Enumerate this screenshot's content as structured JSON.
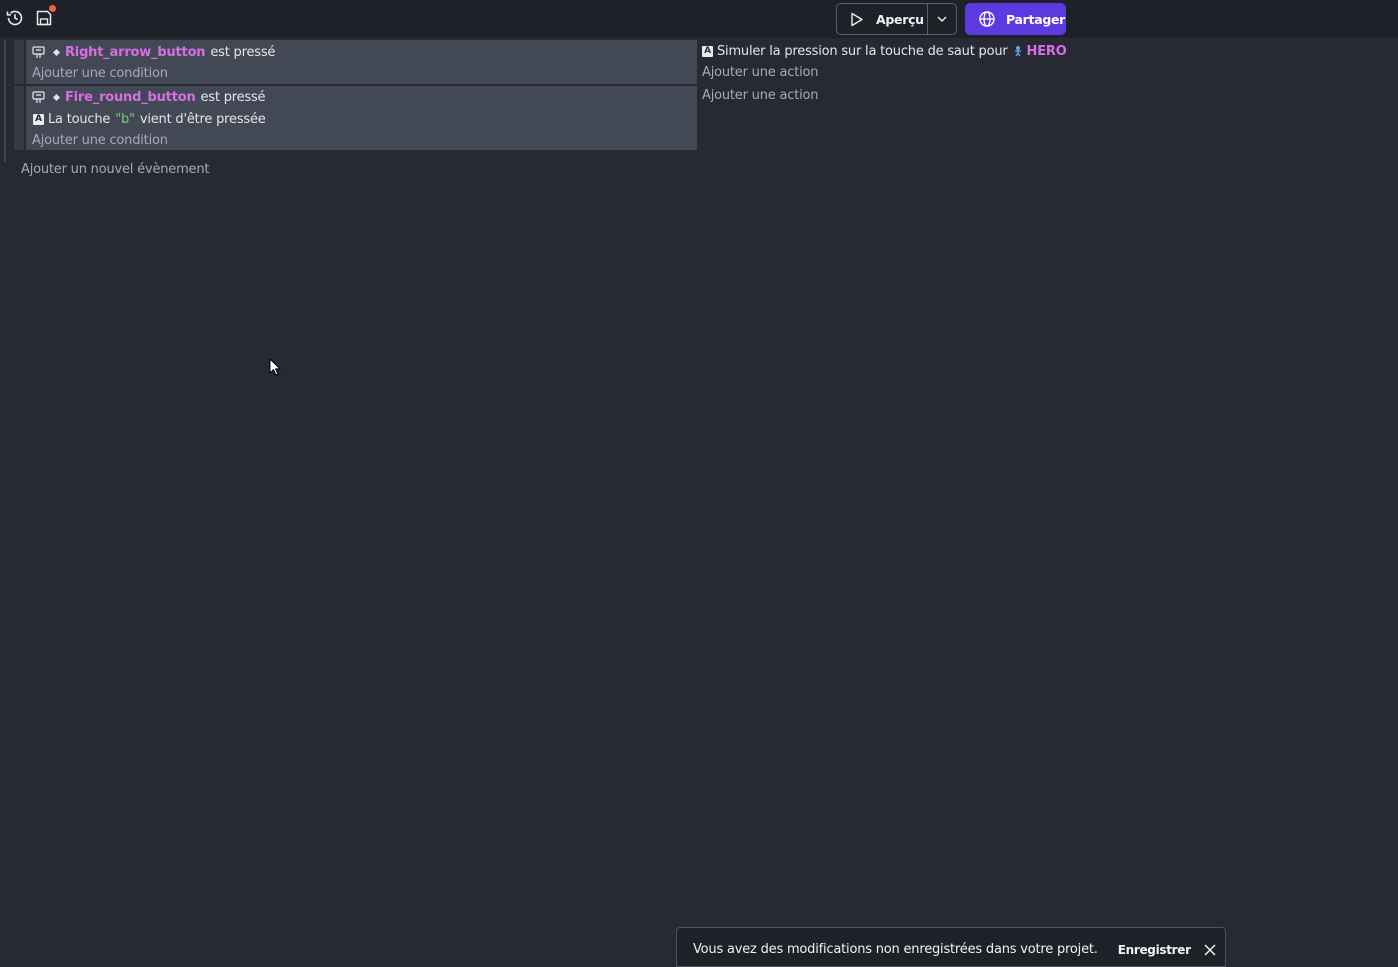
{
  "toolbar": {
    "history_icon": "history-icon",
    "save_icon": "save-icon",
    "preview_label": "Aperçu",
    "share_label": "Partager",
    "accent_color": "#5b3be0",
    "unsaved_badge_color": "#f0623f"
  },
  "events": [
    {
      "conditions": [
        {
          "icon": "touch-icon",
          "object": "Right_arrow_button",
          "text": "est pressé"
        }
      ],
      "add_condition_label": "Ajouter une condition",
      "actions": [
        {
          "icon": "keyboard-icon",
          "text": "Simuler la pression sur la touche de saut pour",
          "object_icon": "hero-sprite-icon",
          "object": "HERO"
        }
      ],
      "add_action_label": "Ajouter une action"
    },
    {
      "conditions": [
        {
          "icon": "touch-icon",
          "object": "Fire_round_button",
          "text": "est pressé"
        },
        {
          "icon": "keyboard-icon",
          "text_before": "La touche",
          "key": "\"b\"",
          "text_after": "vient d'être pressée"
        }
      ],
      "add_condition_label": "Ajouter une condition",
      "actions": [],
      "add_action_label": "Ajouter une action"
    }
  ],
  "add_event_label": "Ajouter un nouvel évènement",
  "snackbar": {
    "message": "Vous avez des modifications non enregistrées dans votre projet.",
    "save_label": "Enregistrer"
  }
}
